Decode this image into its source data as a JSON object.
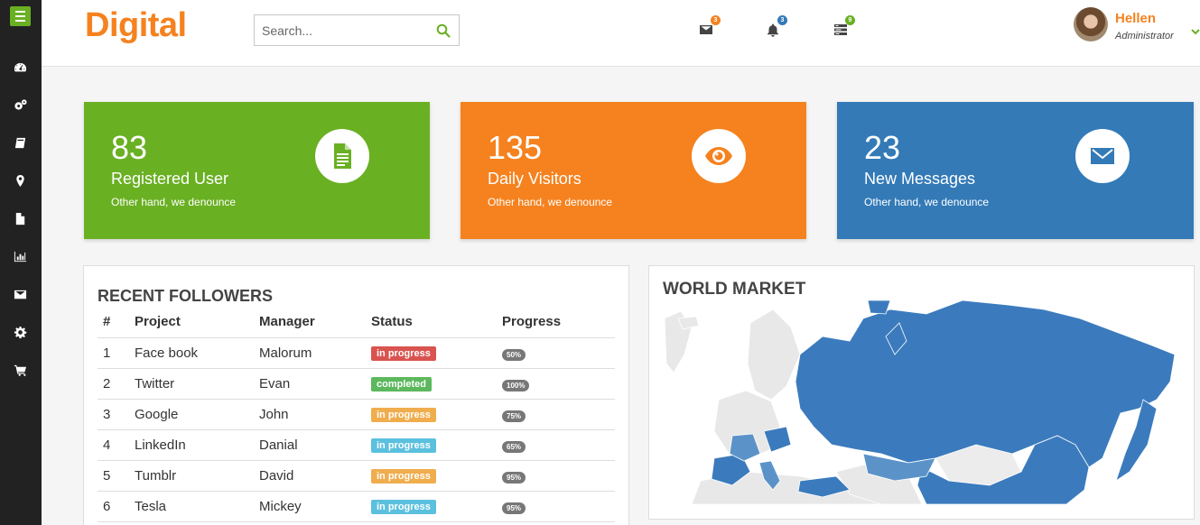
{
  "sidebar": {
    "items": [
      {
        "icon": "dashboard-icon"
      },
      {
        "icon": "cogs-icon"
      },
      {
        "icon": "book-icon"
      },
      {
        "icon": "map-marker-icon"
      },
      {
        "icon": "file-icon"
      },
      {
        "icon": "bar-chart-icon"
      },
      {
        "icon": "envelope-icon"
      },
      {
        "icon": "gear-icon"
      },
      {
        "icon": "shopping-cart-icon"
      }
    ]
  },
  "header": {
    "logo": "Digital",
    "search": {
      "placeholder": "Search...",
      "value": ""
    },
    "notifications": [
      {
        "icon": "envelope-icon",
        "count": "3",
        "color": "#f5821f"
      },
      {
        "icon": "bell-icon",
        "count": "3",
        "color": "#337ab7"
      },
      {
        "icon": "tasks-icon",
        "count": "9",
        "color": "#6ab023"
      }
    ],
    "user": {
      "name": "Hellen",
      "role": "Administrator"
    }
  },
  "stats": [
    {
      "value": "83",
      "label": "Registered User",
      "desc": "Other hand, we denounce",
      "color": "#6ab023",
      "icon": "document-icon"
    },
    {
      "value": "135",
      "label": "Daily Visitors",
      "desc": "Other hand, we denounce",
      "color": "#f5821f",
      "icon": "eye-icon"
    },
    {
      "value": "23",
      "label": "New Messages",
      "desc": "Other hand, we denounce",
      "color": "#337ab7",
      "icon": "envelope-icon"
    }
  ],
  "followers": {
    "title": "RECENT FOLLOWERS",
    "columns": [
      "#",
      "Project",
      "Manager",
      "Status",
      "Progress"
    ],
    "rows": [
      {
        "id": "1",
        "project": "Face book",
        "manager": "Malorum",
        "status": "in progress",
        "status_color": "#d9534f",
        "progress": "50%"
      },
      {
        "id": "2",
        "project": "Twitter",
        "manager": "Evan",
        "status": "completed",
        "status_color": "#5cb85c",
        "progress": "100%"
      },
      {
        "id": "3",
        "project": "Google",
        "manager": "John",
        "status": "in progress",
        "status_color": "#f0ad4e",
        "progress": "75%"
      },
      {
        "id": "4",
        "project": "LinkedIn",
        "manager": "Danial",
        "status": "in progress",
        "status_color": "#5bc0de",
        "progress": "65%"
      },
      {
        "id": "5",
        "project": "Tumblr",
        "manager": "David",
        "status": "in progress",
        "status_color": "#f0ad4e",
        "progress": "95%"
      },
      {
        "id": "6",
        "project": "Tesla",
        "manager": "Mickey",
        "status": "in progress",
        "status_color": "#5bc0de",
        "progress": "95%"
      }
    ]
  },
  "world_market": {
    "title": "WORLD MARKET",
    "colors": {
      "dark": "#3b7bbd",
      "mid": "#5b93c9",
      "light": "#e8e8e8"
    }
  }
}
